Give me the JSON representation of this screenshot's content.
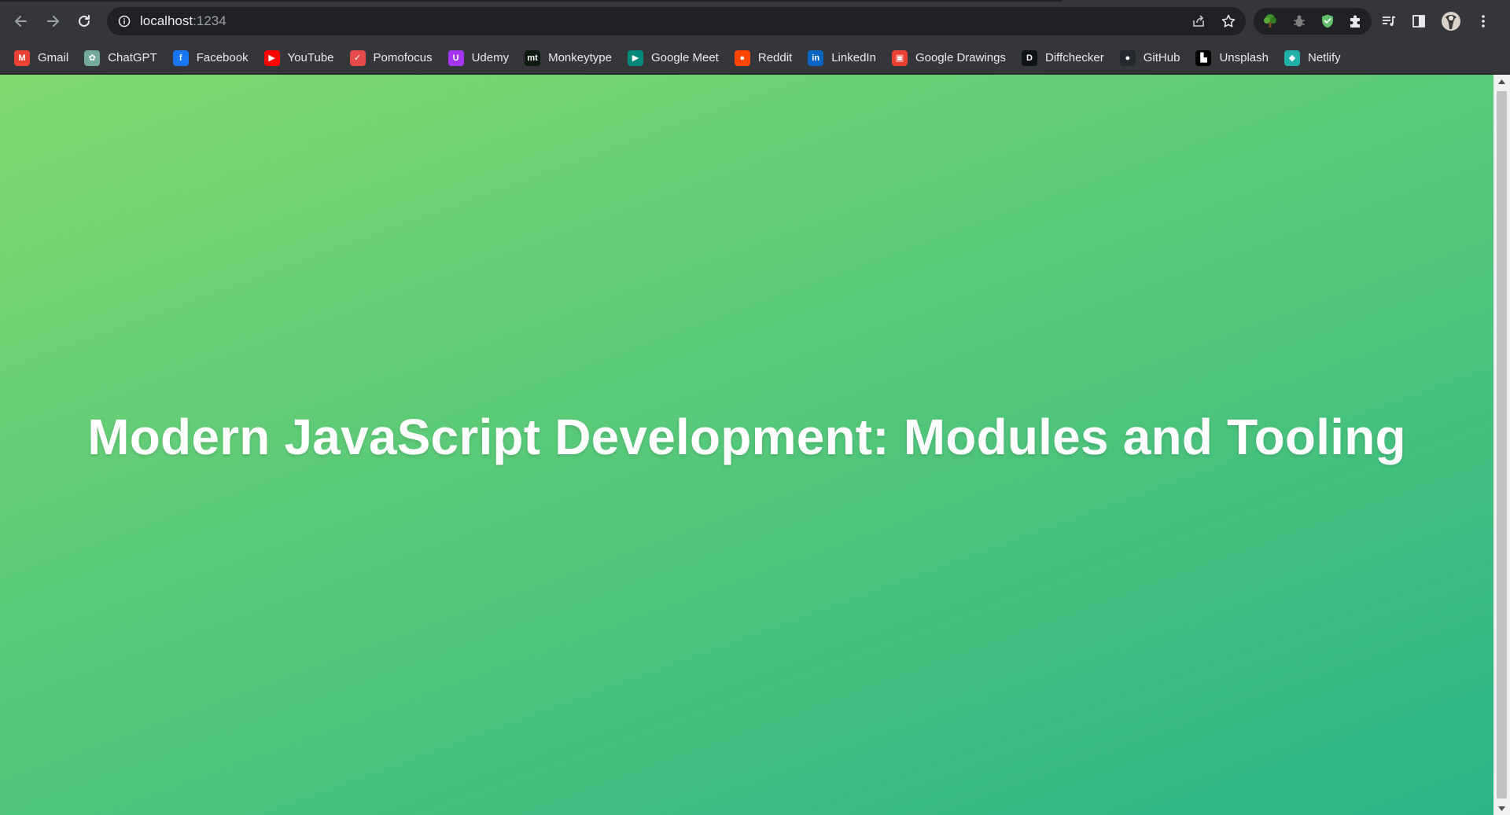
{
  "toolbar": {
    "icons": {
      "back": "arrow-left-icon",
      "forward": "arrow-right-icon",
      "reload": "reload-icon",
      "site_info": "info-icon",
      "share": "share-icon",
      "bookmark": "star-icon",
      "extensions": "puzzle-icon",
      "media": "media-queue-icon",
      "side_panel": "side-panel-icon",
      "menu": "kebab-menu-icon"
    }
  },
  "omnibox": {
    "host": "localhost",
    "port": ":1234"
  },
  "extensions": [
    {
      "name": "tree-extension-icon",
      "color": "#3f8f2e"
    },
    {
      "name": "bug-extension-icon",
      "color": "#7d7f81"
    },
    {
      "name": "shield-extension-icon",
      "color": "#5fbf6a"
    }
  ],
  "bookmarks": [
    {
      "label": "Gmail",
      "icon": "gmail-icon",
      "color": "#ea4335",
      "glyph": "M"
    },
    {
      "label": "ChatGPT",
      "icon": "chatgpt-icon",
      "color": "#74aa9c",
      "glyph": "✿"
    },
    {
      "label": "Facebook",
      "icon": "facebook-icon",
      "color": "#1877f2",
      "glyph": "f"
    },
    {
      "label": "YouTube",
      "icon": "youtube-icon",
      "color": "#ff0000",
      "glyph": "▶"
    },
    {
      "label": "Pomofocus",
      "icon": "pomofocus-icon",
      "color": "#e54b4b",
      "glyph": "✓"
    },
    {
      "label": "Udemy",
      "icon": "udemy-icon",
      "color": "#a435f0",
      "glyph": "U"
    },
    {
      "label": "Monkeytype",
      "icon": "monkeytype-icon",
      "color": "#0f1a12",
      "glyph": "mt"
    },
    {
      "label": "Google Meet",
      "icon": "google-meet-icon",
      "color": "#00897b",
      "glyph": "▶"
    },
    {
      "label": "Reddit",
      "icon": "reddit-icon",
      "color": "#ff4500",
      "glyph": "●"
    },
    {
      "label": "LinkedIn",
      "icon": "linkedin-icon",
      "color": "#0a66c2",
      "glyph": "in"
    },
    {
      "label": "Google Drawings",
      "icon": "google-drawings-icon",
      "color": "#e94235",
      "glyph": "▣"
    },
    {
      "label": "Diffchecker",
      "icon": "diffchecker-icon",
      "color": "#0e1116",
      "glyph": "D"
    },
    {
      "label": "GitHub",
      "icon": "github-icon",
      "color": "#24292f",
      "glyph": "●"
    },
    {
      "label": "Unsplash",
      "icon": "unsplash-icon",
      "color": "#000000",
      "glyph": "▙"
    },
    {
      "label": "Netlify",
      "icon": "netlify-icon",
      "color": "#20b0a8",
      "glyph": "◆"
    }
  ],
  "page": {
    "heading": "Modern JavaScript Development: Modules and Tooling"
  }
}
